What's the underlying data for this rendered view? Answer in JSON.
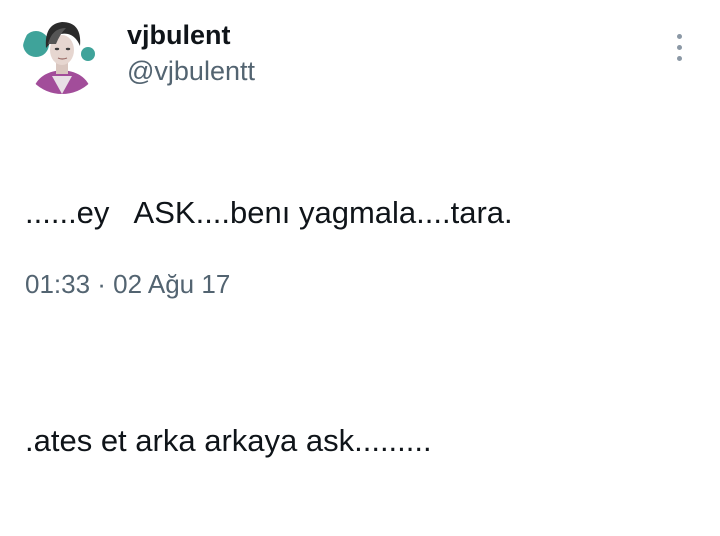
{
  "tweet": {
    "author": {
      "display_name": "vjbulent",
      "handle": "@vjbulentt",
      "avatar": "profile-photo"
    },
    "text_lines": [
      "......ey   ASK....benı yagmala....tara.",
      ".ates et arka arkaya ask........."
    ],
    "timestamp": "01:33 · 02 Ağu 17",
    "more_icon": "more-vertical-icon"
  },
  "colors": {
    "primary_text": "#0f1419",
    "secondary_text": "#536471",
    "icon": "#8b98a5",
    "background": "#ffffff"
  }
}
